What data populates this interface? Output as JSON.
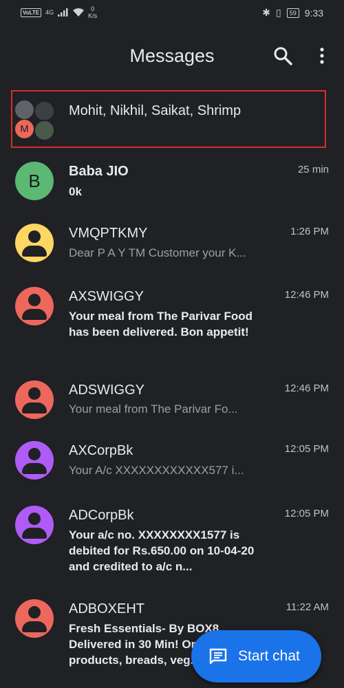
{
  "status_bar": {
    "volte": "VoLTE",
    "network": "4G",
    "net_speed_value": "0",
    "net_speed_unit": "K/s",
    "battery": "59",
    "time": "9:33"
  },
  "app_bar": {
    "title": "Messages",
    "search_icon": "search-icon",
    "more_icon": "more-vert-icon"
  },
  "conversations": [
    {
      "name": "Mohit, Nikhil, Saikat, Shrimp",
      "time": "",
      "snippet": "",
      "avatar_letter": "M",
      "group": true,
      "highlighted": true
    },
    {
      "name": "Baba JIO",
      "time": "25 min",
      "snippet": "0k",
      "avatar_letter": "B",
      "avatar_color": "#5bb974",
      "unread": true
    },
    {
      "name": "VMQPTKMY",
      "time": "1:26 PM",
      "snippet": "Dear P A Y TM Customer your K...",
      "avatar_color": "#fdd663",
      "unread": false
    },
    {
      "name": "AXSWIGGY",
      "time": "12:46 PM",
      "snippet": "Your meal from The Parivar Food has been delivered. Bon appetit!",
      "avatar_color": "#ee675c",
      "unread": true
    },
    {
      "name": "ADSWIGGY",
      "time": "12:46 PM",
      "snippet": "Your meal from The Parivar Fo...",
      "avatar_color": "#ee675c",
      "unread": false
    },
    {
      "name": "AXCorpBk",
      "time": "12:05 PM",
      "snippet": "Your A/c XXXXXXXXXXXX577 i...",
      "avatar_color": "#af5cf7",
      "unread": false
    },
    {
      "name": "ADCorpBk",
      "time": "12:05 PM",
      "snippet": "Your a/c no. XXXXXXXX1577 is debited for Rs.650.00 on 10-04-20 and credited to a/c n...",
      "avatar_color": "#af5cf7",
      "unread": true
    },
    {
      "name": "ADBOXEHT",
      "time": "11:22 AM",
      "snippet": "Fresh Essentials- By BOX8 Delivered in 30 Min! Order products, breads, veg...",
      "avatar_color": "#ee675c",
      "unread": true
    }
  ],
  "fab": {
    "label": "Start chat",
    "icon": "message-icon"
  },
  "colors": {
    "background": "#202124",
    "highlight_border": "#d32f2f",
    "fab": "#1a73e8"
  }
}
